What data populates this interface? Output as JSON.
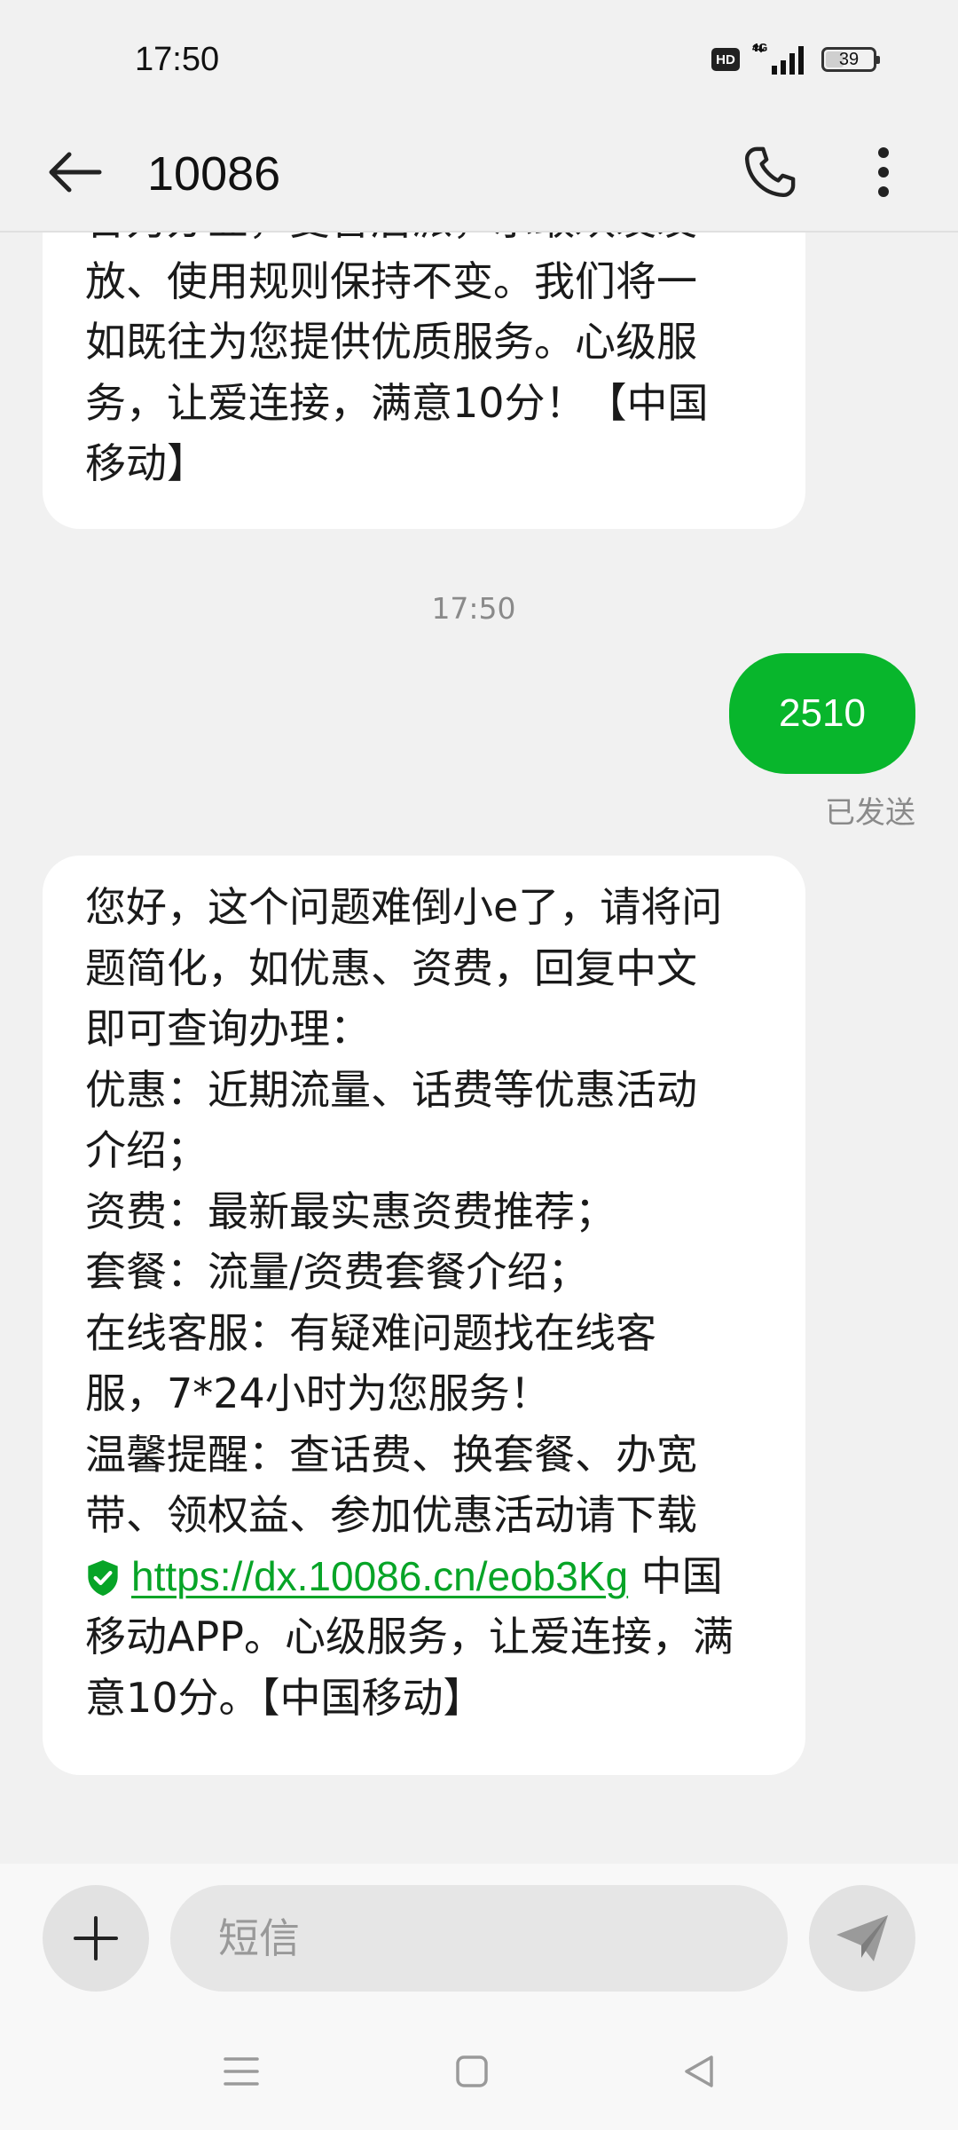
{
  "status_bar": {
    "time": "17:50",
    "hd_label": "HD",
    "network_type": "4G",
    "battery_level": "39",
    "battery_percent": 39
  },
  "header": {
    "title": "10086"
  },
  "messages": [
    {
      "direction": "incoming",
      "text": "合力办业，变言后派，示敢欢发发\n放、使用规则保持不变。我们将一\n如既往为您提供优质服务。心级服\n务，让爱连接，满意10分！【中国\n移动】"
    },
    {
      "direction": "timestamp",
      "text": "17:50"
    },
    {
      "direction": "outgoing",
      "text": "2510",
      "status": "已发送"
    },
    {
      "direction": "incoming",
      "text_before_link": "您好，这个问题难倒小e了，请将问\n题简化，如优惠、资费，回复中文\n即可查询办理：\n优惠：近期流量、话费等优惠活动\n介绍；\n资费：最新最实惠资费推荐；\n套餐：流量/资费套餐介绍；\n在线客服：有疑难问题找在线客\n服，7*24小时为您服务！\n温馨提醒：查话费、换套餐、办宽\n带、领权益、参加优惠活动请下载\n",
      "link": "https://dx.10086.cn/eob3Kg",
      "text_after_link": " 中国\n移动APP。心级服务，让爱连接，满\n意10分。【中国移动】"
    }
  ],
  "compose": {
    "placeholder": "短信"
  },
  "colors": {
    "accent": "#08b62c",
    "link": "#07a427",
    "background": "#f1f1f1",
    "bubble_in": "#ffffff"
  },
  "icons": {
    "back": "arrow-left-icon",
    "call": "phone-icon",
    "more": "more-vertical-icon",
    "add": "plus-icon",
    "send": "send-icon",
    "secure_link": "shield-check-icon"
  }
}
